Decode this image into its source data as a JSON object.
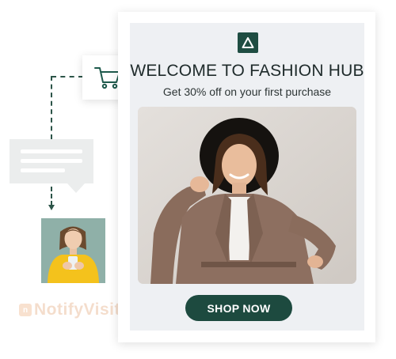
{
  "popup": {
    "headline": "WELCOME TO FASHION HUB",
    "subline": "Get 30% off on your first purchase",
    "cta_label": "SHOP NOW",
    "logo_icon": "triangle-logo-icon",
    "accent_color": "#1d4a3f"
  },
  "side": {
    "cart_icon": "shopping-cart-icon",
    "chat_icon": "chat-bubble-icon",
    "connector_color": "#2c5448"
  },
  "brand": {
    "name": "NotifyVisit"
  }
}
